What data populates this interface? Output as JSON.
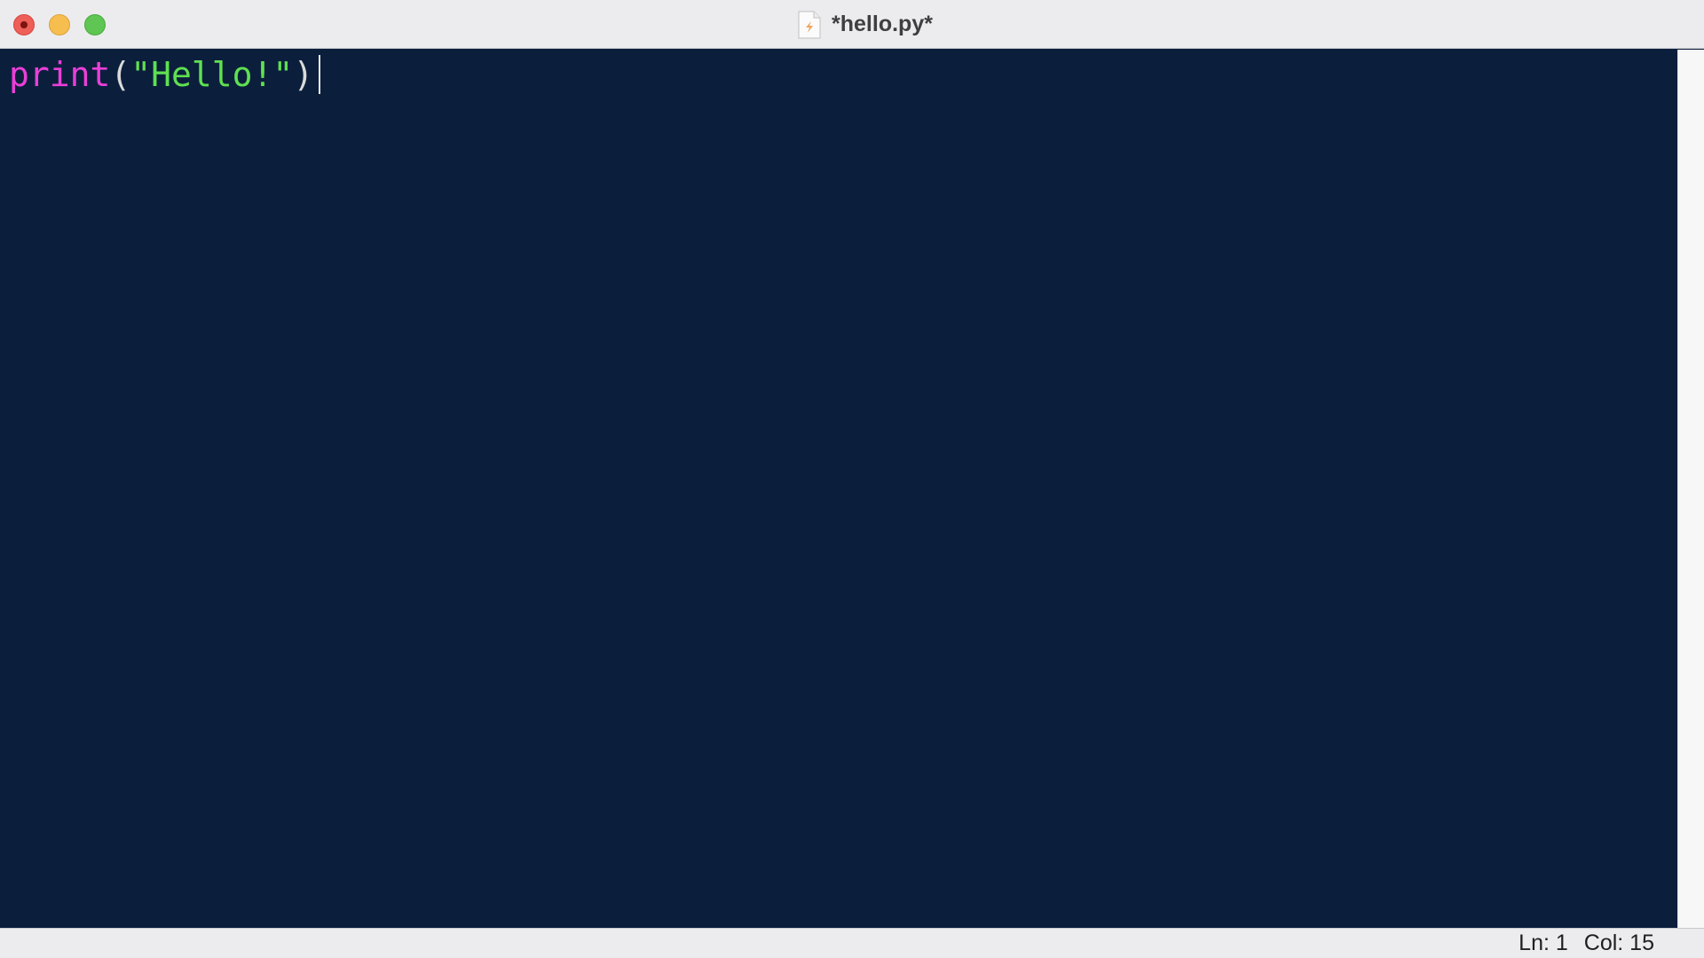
{
  "window": {
    "title": "*hello.py*",
    "file_icon": "python-file-icon"
  },
  "editor": {
    "line": {
      "func": "print",
      "open_paren": "(",
      "string": "\"Hello!\"",
      "close_paren": ")"
    }
  },
  "status": {
    "line": "Ln: 1",
    "col": "Col: 15"
  },
  "colors": {
    "editor_background": "#0b1f3d",
    "builtin": "#ea3fd8",
    "string": "#5fe051",
    "punctuation": "#dadada"
  }
}
